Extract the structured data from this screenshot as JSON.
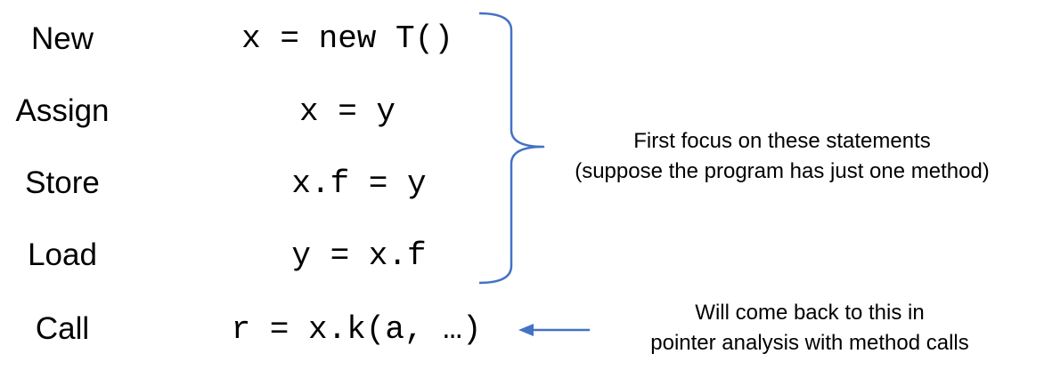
{
  "statements": [
    {
      "kind": "New",
      "code": "x = new T()"
    },
    {
      "kind": "Assign",
      "code": "x = y"
    },
    {
      "kind": "Store",
      "code": "x.f = y"
    },
    {
      "kind": "Load",
      "code": "y = x.f"
    },
    {
      "kind": "Call",
      "code": "r = x.k(a, …)"
    }
  ],
  "brace_note": {
    "line1": "First focus on these statements",
    "line2": "(suppose the program has just one method)"
  },
  "arrow_note": {
    "line1": "Will come back to this in",
    "line2": "pointer analysis with method calls"
  },
  "colors": {
    "brace": "#4472C4",
    "arrow": "#4472C4",
    "text": "#000000"
  }
}
